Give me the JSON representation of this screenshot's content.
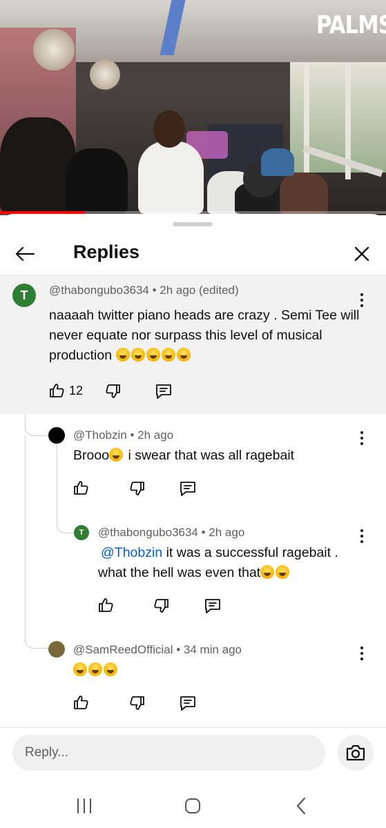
{
  "video": {
    "channel_logo": "PALMS",
    "progress_fraction": 0.22
  },
  "header": {
    "title": "Replies",
    "back_icon": "arrow-left-icon",
    "close_icon": "close-icon"
  },
  "parent_comment": {
    "avatar_letter": "T",
    "avatar_color": "#2e7d32",
    "author": "@thabongubo3634",
    "meta": " • 2h ago (edited)",
    "text": "naaaah twitter piano heads are crazy . Semi Tee will never equate nor surpass this level of musical production",
    "emoji_count": 5,
    "likes": "12"
  },
  "replies": [
    {
      "avatar_color": "#000000",
      "author": "@Thobzin",
      "meta": " • 2h ago",
      "text_before_emoji": "Brooo",
      "text_after_emoji": " i swear that was all ragebait"
    },
    {
      "avatar_letter": "T",
      "avatar_color": "#2e7d32",
      "author": "@thabongubo3634",
      "meta": " • 2h ago",
      "mention": "@Thobzin",
      "text": " it was a successful ragebait . what the hell was even that"
    },
    {
      "avatar_color": "#7a6a3a",
      "author": "@SamReedOfficial",
      "meta": " • 34 min ago",
      "emoji_count": 3
    }
  ],
  "reply_box": {
    "placeholder": "Reply...",
    "camera_icon": "camera-icon"
  },
  "nav": {
    "recents_icon": "recents-icon",
    "home_icon": "home-icon",
    "back_icon": "back-icon"
  },
  "colors": {
    "accent_link": "#065fd4",
    "parent_bg": "#f2f2f2",
    "progress": "#ff0000"
  }
}
